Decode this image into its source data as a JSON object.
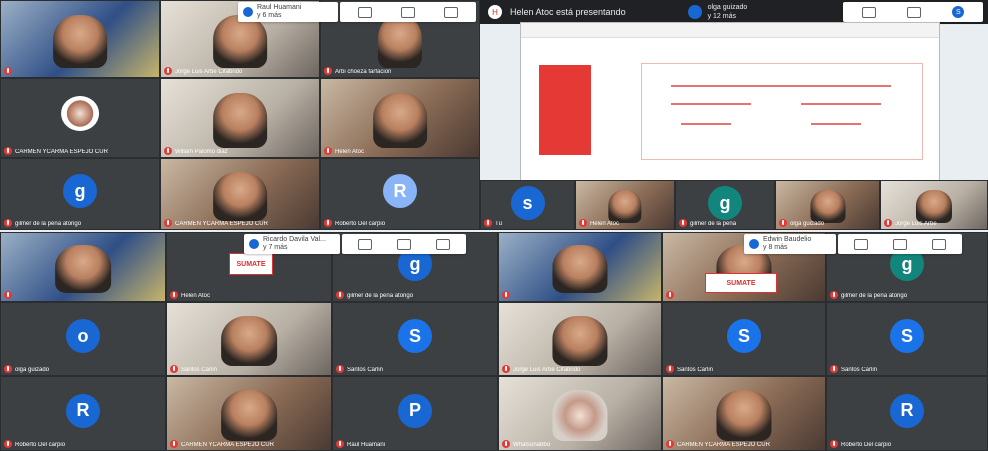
{
  "presenting": {
    "text": "Helen Atoc está presentando",
    "initial": "H"
  },
  "topbars": {
    "left": {
      "line1": "Raul Huamani",
      "line2": "y 6 más"
    },
    "right": {
      "line1": "olga guizado",
      "line2": "y 12 más",
      "avatar": "S"
    }
  },
  "tiles": {
    "r1c1": "",
    "r1c2": "Jorge Luis Arbe Cifabrido",
    "r1c3": "Arbi choeza farfacion",
    "r2c1": "CARMEN YCARMA ESPEJO CUR",
    "r2c2": "Willam Palomo diaz",
    "r2c3": "Helen Atoc",
    "r3c1": "gilmer de la peña atongo",
    "r3c2": "CARMEN YCARMA ESPEJO CUR",
    "r3c3": "Roberto Del carpio",
    "r3c4": "Tú",
    "r3c5": "Helen Atoc",
    "r3c6": "gilmer de la peña",
    "r3c7": "olga guizado",
    "r3c8": "Jorge Luis Arbe"
  },
  "avatars": {
    "g": "g",
    "R": "R",
    "s": "s",
    "S": "S",
    "o": "o",
    "P": "P"
  },
  "lower": {
    "topbar": {
      "line1": "Ricardo Davila Val...",
      "line2": "y 7 más"
    },
    "topbar2": {
      "line1": "Edwin Baudelio",
      "line2": "y 8 más"
    },
    "a1": "",
    "a2": "Helen Atoc",
    "a3": "gilmer de la peña atongo",
    "a4": "",
    "a5": "",
    "a6": "gilmer de la peña atongo",
    "b1": "olga guizado",
    "b2": "Santos Carlin",
    "b3": "Santos Carlin",
    "b4": "Jorge Luis Arbe Cifabrido",
    "b5": "Santos Carlin",
    "b6": "Santos Carlin",
    "c1": "Roberto Del carpio",
    "c2": "CARMEN YCARMA ESPEJO CUR",
    "c3": "Raul Huamani",
    "c4": "Whatsonabbo",
    "c5": "CARMEN YCARMA ESPEJO CUR",
    "c6": "Roberto Del carpio"
  },
  "brand": "SUMATE"
}
